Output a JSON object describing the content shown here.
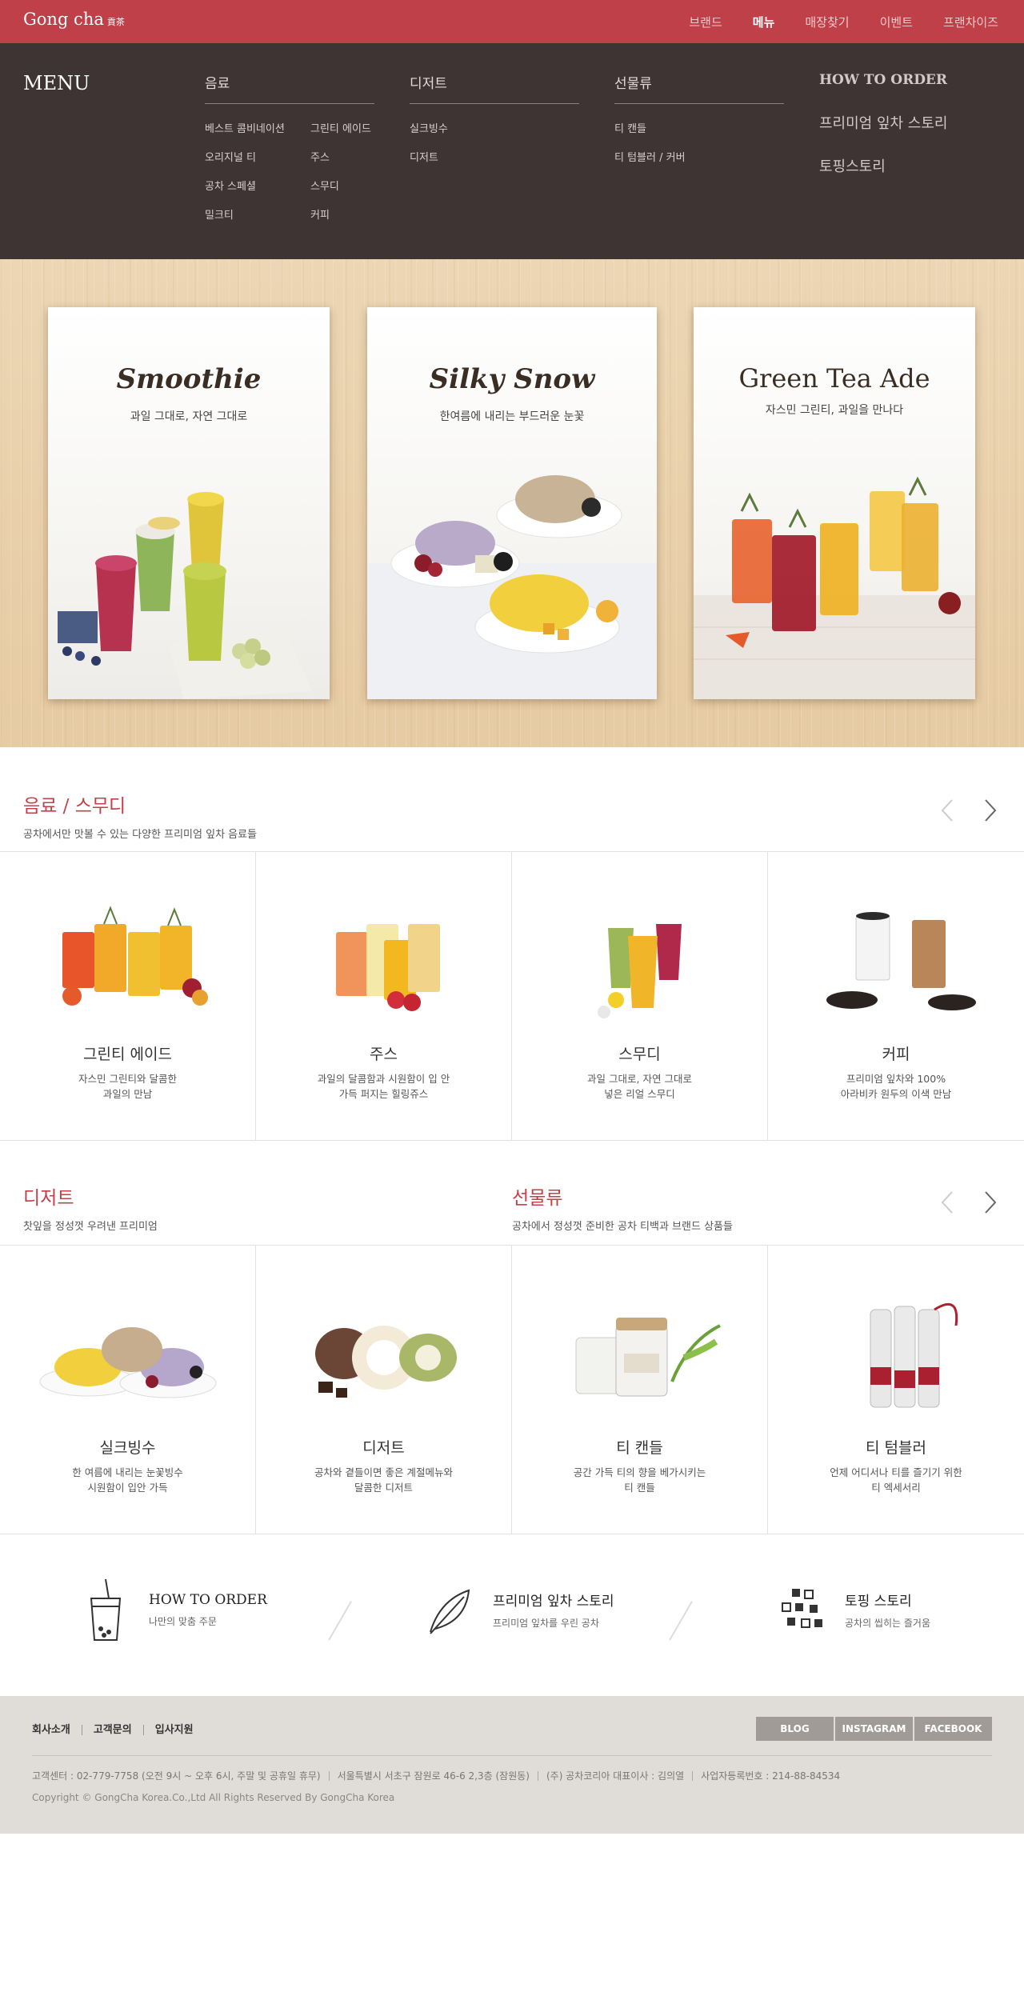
{
  "header": {
    "logo": "Gong cha",
    "logo_sub": "貢茶",
    "nav": [
      "브랜드",
      "메뉴",
      "매장찾기",
      "이벤트",
      "프랜차이즈"
    ],
    "active_index": 1
  },
  "mega": {
    "title": "MENU",
    "col1": {
      "title": "음료",
      "items": [
        "베스트 콤비네이션",
        "그린티 에이드",
        "오리지널 티",
        "주스",
        "공차 스페셜",
        "스무디",
        "밀크티",
        "커피"
      ]
    },
    "col2": {
      "title": "디저트",
      "items": [
        "실크빙수",
        "디저트"
      ]
    },
    "col3": {
      "title": "선물류",
      "items": [
        "티 캔들",
        "티 텀블러 / 커버"
      ]
    },
    "col4": {
      "items": [
        "HOW TO ORDER",
        "프리미엄 잎차 스토리",
        "토핑스토리"
      ]
    }
  },
  "hero": {
    "cards": [
      {
        "title": "Smoothie",
        "sub": "과일 그대로, 자연 그대로"
      },
      {
        "title": "Silky Snow",
        "sub": "한여름에 내리는 부드러운 눈꽃"
      },
      {
        "title": "Green Tea Ade",
        "sub": "자스민 그린티, 과일을 만나다"
      }
    ]
  },
  "drinks": {
    "title": "음료 / 스무디",
    "desc": "공차에서만 맛볼 수 있는 다양한 프리미엄 잎차 음료들",
    "items": [
      {
        "name": "그린티 에이드",
        "line1": "자스민 그린티와 달콤한",
        "line2": "과일의 만남"
      },
      {
        "name": "주스",
        "line1": "과일의 달콤함과 시원함이 입 안",
        "line2": "가득 퍼지는 힐링쥬스"
      },
      {
        "name": "스무디",
        "line1": "과일 그대로, 자연 그대로",
        "line2": "넣은 리얼 스무디"
      },
      {
        "name": "커피",
        "line1": "프리미엄 잎차와 100%",
        "line2": "아라비카 원두의 이색 만남"
      }
    ]
  },
  "dessert": {
    "title": "디저트",
    "desc": "찻잎을 정성껏 우려낸 프리미엄"
  },
  "gifts": {
    "title": "선물류",
    "desc": "공차에서 정성껏 준비한 공차 티백과 브랜드 상품들"
  },
  "second_items": [
    {
      "name": "실크빙수",
      "line1": "한 여름에 내리는 눈꽃빙수",
      "line2": "시원함이 입안 가득"
    },
    {
      "name": "디저트",
      "line1": "공차와 곁들이면 좋은 계절메뉴와",
      "line2": "달콤한 디저트"
    },
    {
      "name": "티 캔들",
      "line1": "공간 가득 티의 향을 베가시키는",
      "line2": "티 캔들"
    },
    {
      "name": "티 텀블러",
      "line1": "언제 어디서나 티를 즐기기 위한",
      "line2": "티 엑세서리"
    }
  ],
  "quick": [
    {
      "title": "HOW TO ORDER",
      "desc": "나만의 맞춤 주문",
      "icon": "bubble-tea-icon"
    },
    {
      "title": "프리미엄 잎차 스토리",
      "desc": "프리미엄 잎차를 우린 공차",
      "icon": "leaf-icon"
    },
    {
      "title": "토핑 스토리",
      "desc": "공차의 씹히는 즐거움",
      "icon": "toppings-icon"
    }
  ],
  "footer": {
    "links": [
      "회사소개",
      "고객문의",
      "입사지원"
    ],
    "sns": [
      "BLOG",
      "INSTAGRAM",
      "FACEBOOK"
    ],
    "info": [
      "고객센터 : 02-779-7758 (오전 9시 ~ 오후 6시, 주말 및 공휴일 휴무)",
      "서울특별시 서초구 잠원로 46-6 2,3층 (잠원동)",
      "(주) 공차코리아 대표이사 : 김의열",
      "사업자등록번호 : 214-88-84534"
    ],
    "copyright": "Copyright © GongCha Korea.Co.,Ltd All Rights Reserved By GongCha Korea"
  },
  "colors": {
    "brand_red": "#c0404a",
    "menu_bg": "#3d3433",
    "footer_bg": "#e0dcd8"
  }
}
